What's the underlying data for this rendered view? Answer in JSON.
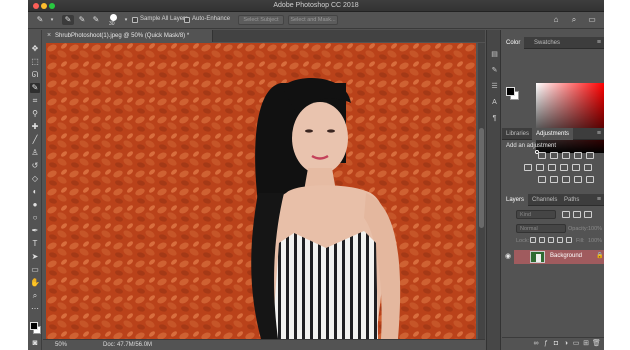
{
  "app": {
    "title": "Adobe Photoshop CC 2018"
  },
  "options_bar": {
    "brush_size": "30",
    "sample_all_layers": "Sample All Layers",
    "auto_enhance": "Auto-Enhance",
    "select_subject": "Select Subject",
    "select_and_mask": "Select and Mask..."
  },
  "document": {
    "tab_title": "ShrubPhotoshoot(1).jpeg @ 50% (Quick Mask/8) *",
    "close_glyph": "×"
  },
  "status_bar": {
    "zoom": "50%",
    "doc_size": "Doc: 47.7M/56.0M"
  },
  "color_panel": {
    "tabs": [
      "Color",
      "Swatches"
    ],
    "active_tab": "Color",
    "foreground": "#000000",
    "background": "#ffffff"
  },
  "adjustments_panel": {
    "tabs": [
      "Libraries",
      "Adjustments"
    ],
    "active_tab": "Adjustments",
    "heading": "Add an adjustment"
  },
  "layers_panel": {
    "tabs": [
      "Layers",
      "Channels",
      "Paths"
    ],
    "active_tab": "Layers",
    "search_placeholder": "Kind",
    "blend_mode": "Normal",
    "opacity_label": "Opacity:",
    "opacity_value": "100%",
    "lock_label": "Lock:",
    "fill_label": "Fill:",
    "fill_value": "100%",
    "layers": [
      {
        "name": "Background",
        "visible": true,
        "locked": true
      }
    ]
  },
  "colors": {
    "quick_mask_overlay": "#c0461c",
    "selected_layer_row": "#a05b5e"
  }
}
